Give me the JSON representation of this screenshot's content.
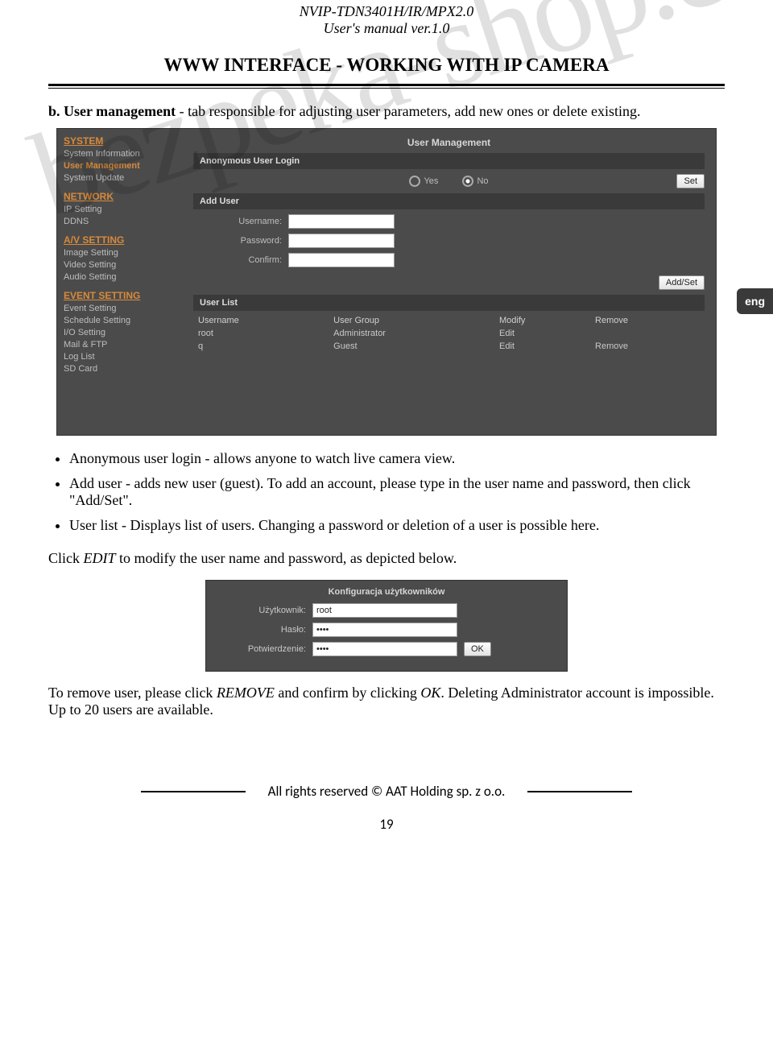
{
  "header": {
    "line1": "NVIP-TDN3401H/IR/MPX2.0",
    "line2": "User's manual ver.1.0"
  },
  "section_title": "WWW INTERFACE - WORKING WITH IP CAMERA",
  "lang_tab": "eng",
  "watermark": "bezpeka-shop.com",
  "intro": {
    "prefix": "b.",
    "bold": "User management",
    "rest": " - tab responsible for adjusting user parameters, add new ones or delete existing."
  },
  "screenshot1": {
    "sidebar": {
      "groups": [
        {
          "title": "SYSTEM",
          "items": [
            "System Information",
            "User Management",
            "System Update"
          ],
          "active_index": 1
        },
        {
          "title": "NETWORK",
          "items": [
            "IP Setting",
            "DDNS"
          ]
        },
        {
          "title": "A/V SETTING",
          "items": [
            "Image Setting",
            "Video Setting",
            "Audio Setting"
          ]
        },
        {
          "title": "EVENT SETTING",
          "items": [
            "Event Setting",
            "Schedule Setting",
            "I/O Setting",
            "Mail & FTP",
            "Log List",
            "SD Card"
          ]
        }
      ]
    },
    "panel_title": "User Management",
    "anon_label": "Anonymous User Login",
    "radio": {
      "yes": "Yes",
      "no": "No",
      "selected": "no"
    },
    "set_btn": "Set",
    "adduser_label": "Add User",
    "fields": {
      "username": "Username:",
      "password": "Password:",
      "confirm": "Confirm:"
    },
    "addset_btn": "Add/Set",
    "userlist_label": "User List",
    "table": {
      "headers": [
        "Username",
        "User Group",
        "Modify",
        "Remove"
      ],
      "rows": [
        [
          "root",
          "Administrator",
          "Edit",
          ""
        ],
        [
          "q",
          "Guest",
          "Edit",
          "Remove"
        ]
      ]
    }
  },
  "bullets": [
    "Anonymous user login - allows anyone to watch live camera view.",
    "Add user  - adds new user (guest). To add an account, please type in the user name and password, then click \"Add/Set\".",
    "User list - Displays list of users. Changing a password or deletion of a user is possible here."
  ],
  "click_edit": {
    "pre": "Click ",
    "em": "EDIT",
    "post": " to modify the user name and password, as depicted below."
  },
  "screenshot2": {
    "title": "Konfiguracja użytkowników",
    "rows": {
      "user_label": "Użytkownik:",
      "user_value": "root",
      "pass_label": "Hasło:",
      "pass_value": "••••",
      "conf_label": "Potwierdzenie:",
      "conf_value": "••••"
    },
    "ok_btn": "OK"
  },
  "remove_p": {
    "pre": "To remove user, please click ",
    "em1": "REMOVE",
    "mid": "  and confirm by clicking ",
    "em2": "OK",
    "post": ". Deleting Administrator account is impossible. Up to 20 users are available."
  },
  "footer": "All rights reserved © AAT Holding sp. z o.o.",
  "page_num": "19"
}
